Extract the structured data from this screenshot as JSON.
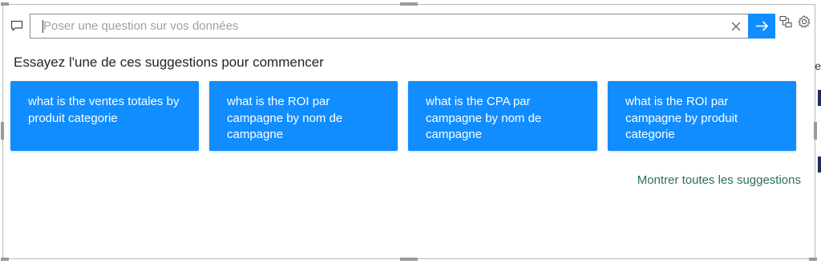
{
  "search": {
    "placeholder": "Poser une question sur vos données",
    "value": ""
  },
  "heading": "Essayez l'une de ces suggestions pour commencer",
  "suggestions": [
    {
      "label": "what is the ventes totales by produit categorie"
    },
    {
      "label": "what is the ROI par campagne by nom de campagne"
    },
    {
      "label": "what is the CPA par campagne by nom de campagne"
    },
    {
      "label": "what is the ROI par campagne by produit categorie"
    }
  ],
  "show_all_label": "Montrer toutes les suggestions",
  "icons": {
    "chat": "chat-bubble-icon",
    "clear": "close-icon",
    "submit": "arrow-right-icon",
    "convert": "convert-to-visual-icon",
    "settings": "gear-icon"
  },
  "colors": {
    "accent": "#118dff",
    "link": "#2b6e5e",
    "card_text": "#ffffff"
  }
}
